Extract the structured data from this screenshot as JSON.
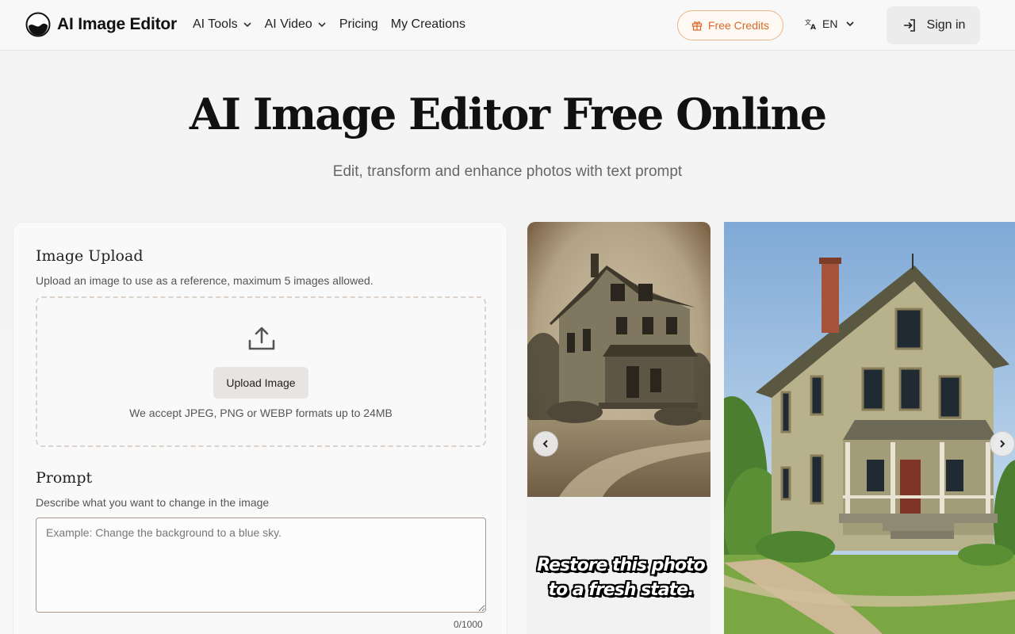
{
  "header": {
    "logo_text": "AI Image Editor",
    "nav": [
      {
        "label": "AI Tools",
        "has_dropdown": true
      },
      {
        "label": "AI Video",
        "has_dropdown": true
      },
      {
        "label": "Pricing",
        "has_dropdown": false
      },
      {
        "label": "My Creations",
        "has_dropdown": false
      }
    ],
    "free_credits_label": "Free Credits",
    "language_label": "EN",
    "signin_label": "Sign in"
  },
  "hero": {
    "title": "AI Image Editor Free Online",
    "subtitle": "Edit, transform and enhance photos with text prompt"
  },
  "upload": {
    "title": "Image Upload",
    "description": "Upload an image to use as a reference, maximum 5 images allowed.",
    "button_label": "Upload Image",
    "hint": "We accept JPEG, PNG or WEBP formats up to 24MB"
  },
  "prompt": {
    "title": "Prompt",
    "description": "Describe what you want to change in the image",
    "placeholder": "Example: Change the background to a blue sky.",
    "value": "",
    "counter": "0/1000"
  },
  "carousel": {
    "caption_line1": "Restore this photo",
    "caption_line2": "to a fresh state.",
    "prev_icon": "chevron-left-icon",
    "next_icon": "chevron-right-icon"
  },
  "colors": {
    "accent": "#d9692a",
    "accent_border": "#e9b58a",
    "text_dark": "#111111",
    "text_muted": "#666666"
  }
}
